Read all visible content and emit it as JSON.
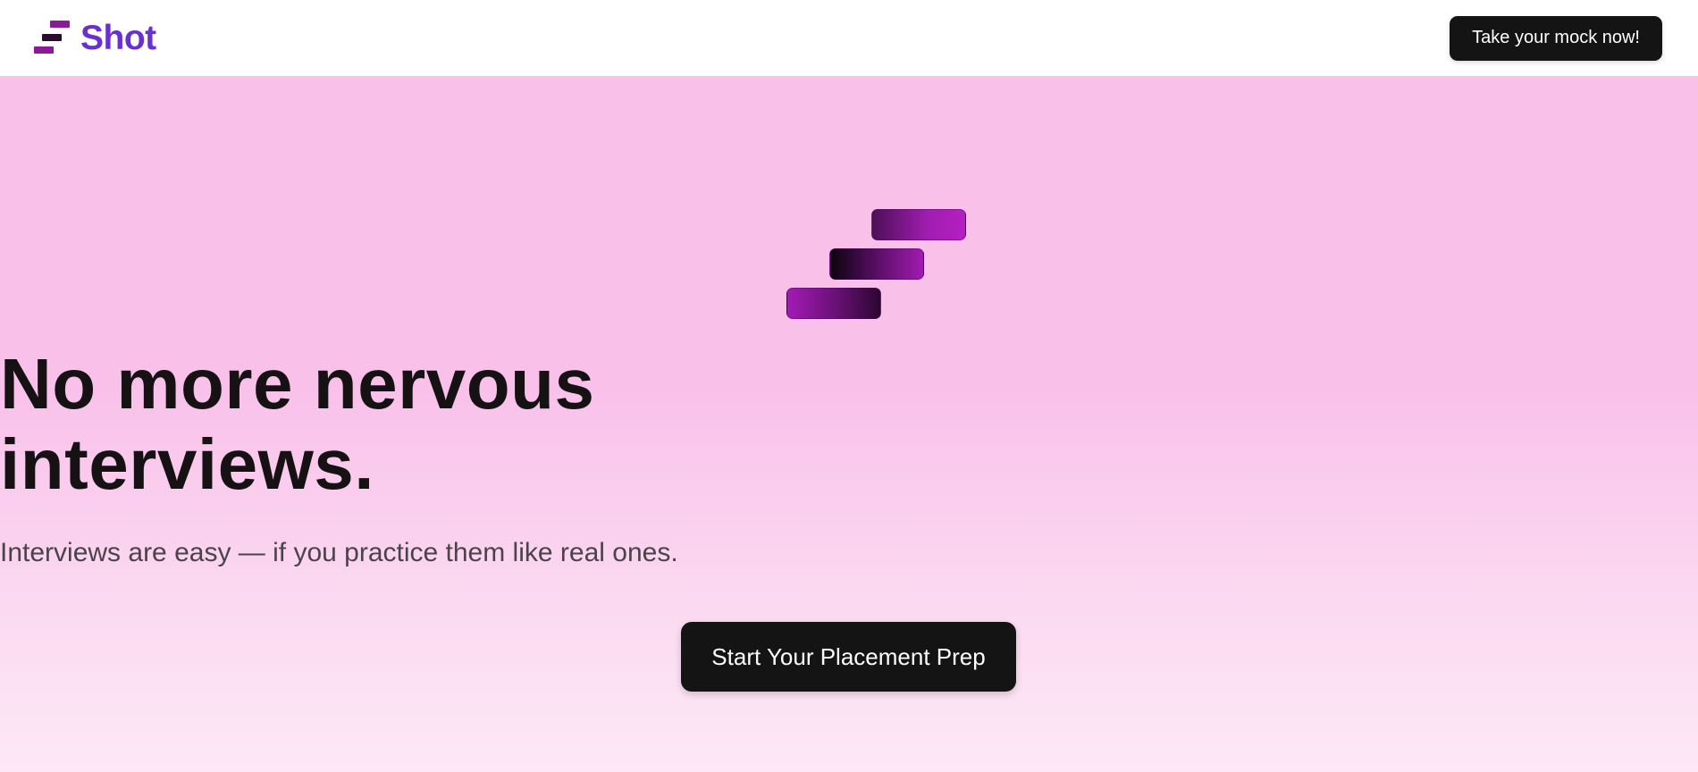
{
  "header": {
    "brand_name": "Shot",
    "logo_icon": "stacked-bars-logo-icon",
    "cta_label": "Take your mock now!"
  },
  "hero": {
    "logo_icon": "stacked-bars-logo-icon",
    "headline_line1": "No more nervous",
    "headline_line2": "interviews.",
    "subtitle": "Interviews are easy — if you practice them like real ones.",
    "cta_label": "Start Your Placement Prep"
  },
  "colors": {
    "brand_text": "#6a2fd1",
    "logo_purple": "#8b1a98",
    "hero_background": "#f9c1ea",
    "button_dark": "#141414"
  }
}
